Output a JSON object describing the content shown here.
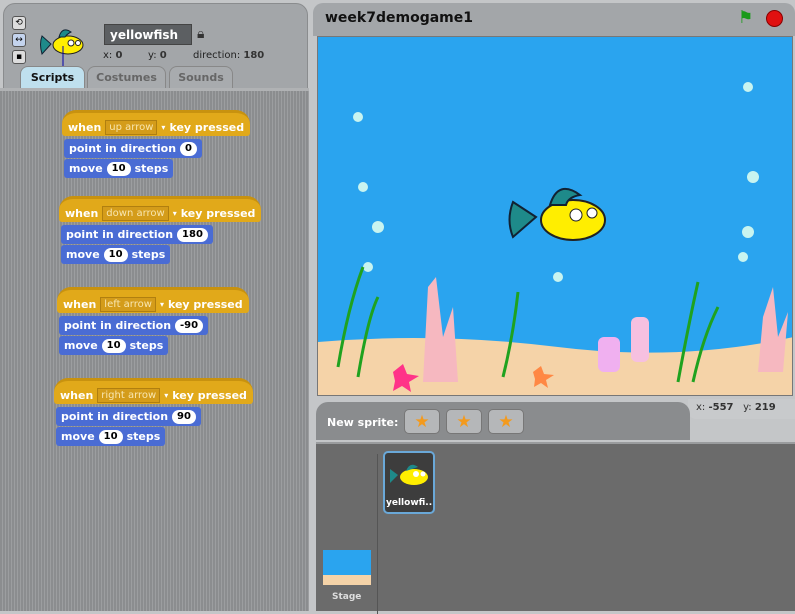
{
  "sprite": {
    "name": "yellowfish",
    "x_label": "x:",
    "x": "0",
    "y_label": "y:",
    "y": "0",
    "direction_label": "direction:",
    "direction": "180"
  },
  "tabs": [
    {
      "label": "Scripts",
      "active": true
    },
    {
      "label": "Costumes"
    },
    {
      "label": "Sounds"
    }
  ],
  "scripts": [
    {
      "when": "when",
      "key": "up arrow",
      "pressed": "key pressed",
      "point": "point in direction",
      "dir": "0",
      "move": "move",
      "steps_val": "10",
      "steps": "steps"
    },
    {
      "when": "when",
      "key": "down arrow",
      "pressed": "key pressed",
      "point": "point in direction",
      "dir": "180",
      "move": "move",
      "steps_val": "10",
      "steps": "steps"
    },
    {
      "when": "when",
      "key": "left arrow",
      "pressed": "key pressed",
      "point": "point in direction",
      "dir": "-90",
      "move": "move",
      "steps_val": "10",
      "steps": "steps"
    },
    {
      "when": "when",
      "key": "right arrow",
      "pressed": "key pressed",
      "point": "point in direction",
      "dir": "90",
      "move": "move",
      "steps_val": "10",
      "steps": "steps"
    }
  ],
  "project": {
    "title": "week7demogame1"
  },
  "colors": {
    "hat": "#e1a91a",
    "motion": "#4a6cd4",
    "stage_water": "#2aa4ef",
    "sand": "#f5d3a8"
  },
  "mouse": {
    "x_label": "x:",
    "x": "-557",
    "y_label": "y:",
    "y": "219"
  },
  "sprite_bar": {
    "new_sprite": "New sprite:"
  },
  "sprites": [
    {
      "label": "yellowfi.."
    }
  ],
  "stage_label": "Stage"
}
